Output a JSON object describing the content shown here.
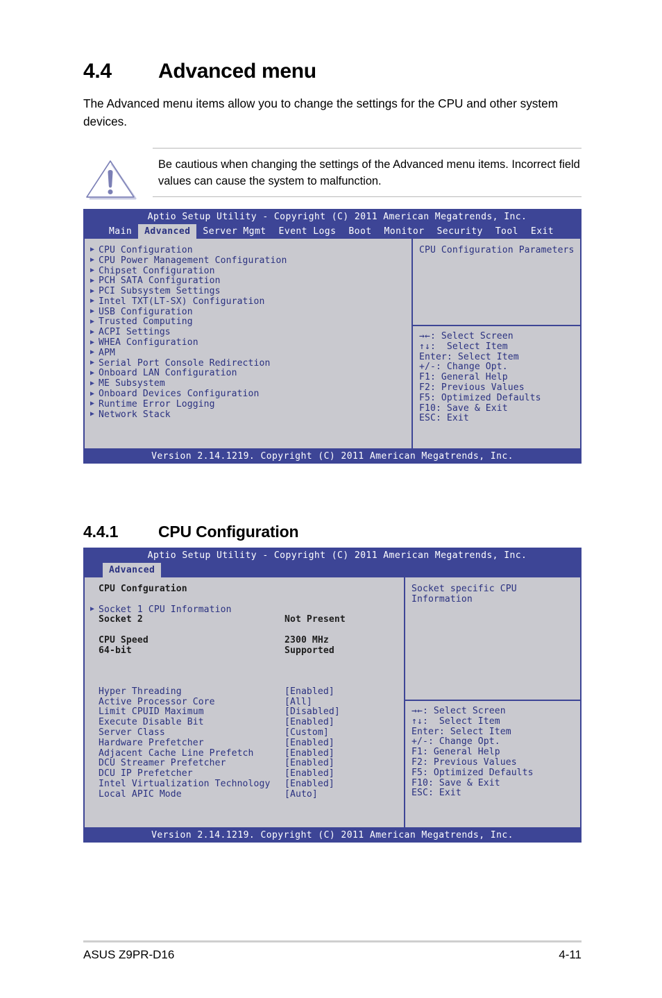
{
  "document": {
    "section": {
      "number": "4.4",
      "title": "Advanced menu"
    },
    "intro": "The Advanced menu items allow you to change the settings for the CPU and other system devices.",
    "note": {
      "icon": "warning-triangle-icon",
      "text": "Be cautious when changing the settings of the Advanced menu items. Incorrect field values can cause the system to malfunction."
    },
    "subsection": {
      "number": "4.4.1",
      "title": "CPU Configuration"
    },
    "footer": {
      "left": "ASUS Z9PR-D16",
      "page": "4-11"
    }
  },
  "colors": {
    "bios_blue": "#3d4596",
    "bios_body": "#c9c9cf",
    "bios_text_blue": "#2a3180",
    "bios_text_white": "#ffffff",
    "note_rule": "#b9b9b9",
    "warning_icon": "#7b7fb5"
  },
  "bios_advanced": {
    "title": "Aptio Setup Utility - Copyright (C) 2011 American Megatrends, Inc.",
    "tabs": [
      {
        "label": "Main",
        "active": false
      },
      {
        "label": "Advanced",
        "active": true
      },
      {
        "label": "Server Mgmt",
        "active": false
      },
      {
        "label": "Event Logs",
        "active": false
      },
      {
        "label": "Boot",
        "active": false
      },
      {
        "label": "Monitor",
        "active": false
      },
      {
        "label": "Security",
        "active": false
      },
      {
        "label": "Tool",
        "active": false
      },
      {
        "label": "Exit",
        "active": false
      }
    ],
    "menu_items": [
      "CPU Configuration",
      "CPU Power Management Configuration",
      "Chipset Configuration",
      "PCH SATA Configuration",
      "PCI Subsystem Settings",
      "Intel TXT(LT-SX) Configuration",
      "USB Configuration",
      "Trusted Computing",
      "ACPI Settings",
      "WHEA Configuration",
      "APM",
      "Serial Port Console Redirection",
      "Onboard LAN Configuration",
      "ME Subsystem",
      "Onboard Devices Configuration",
      "Runtime Error Logging",
      "Network Stack"
    ],
    "help_title": "CPU Configuration Parameters",
    "help_keys": [
      "→←: Select Screen",
      "↑↓:  Select Item",
      "Enter: Select Item",
      "+/-: Change Opt.",
      "F1: General Help",
      "F2: Previous Values",
      "F5: Optimized Defaults",
      "F10: Save & Exit",
      "ESC: Exit"
    ],
    "version": "Version 2.14.1219. Copyright (C) 2011 American Megatrends, Inc."
  },
  "bios_cpu": {
    "title": "Aptio Setup Utility - Copyright (C) 2011 American Megatrends, Inc.",
    "tabs": [
      {
        "label": "Advanced",
        "active": true
      }
    ],
    "section_header": "CPU Confguration",
    "socket_link": "Socket 1 CPU Information",
    "info_rows": [
      {
        "label": "Socket 2",
        "value": "Not Present"
      }
    ],
    "spec_rows": [
      {
        "label": "CPU Speed",
        "value": "2300 MHz"
      },
      {
        "label": "64-bit",
        "value": "Supported"
      }
    ],
    "settings": [
      {
        "label": "Hyper Threading",
        "value": "[Enabled]"
      },
      {
        "label": "Active Processor Core",
        "value": "[All]"
      },
      {
        "label": "Limit CPUID Maximum",
        "value": "[Disabled]"
      },
      {
        "label": "Execute Disable Bit",
        "value": "[Enabled]"
      },
      {
        "label": "Server Class",
        "value": "[Custom]"
      },
      {
        "label": "Hardware Prefetcher",
        "value": "[Enabled]"
      },
      {
        "label": "Adjacent Cache Line Prefetch",
        "value": "[Enabled]"
      },
      {
        "label": "DCU Streamer Prefetcher",
        "value": "[Enabled]"
      },
      {
        "label": "DCU IP Prefetcher",
        "value": "[Enabled]"
      },
      {
        "label": "Intel Virtualization Technology",
        "value": "[Enabled]"
      },
      {
        "label": "Local APIC Mode",
        "value": "[Auto]"
      }
    ],
    "help_title": "Socket specific CPU Information",
    "help_keys": [
      "→←: Select Screen",
      "↑↓:  Select Item",
      "Enter: Select Item",
      "+/-: Change Opt.",
      "F1: General Help",
      "F2: Previous Values",
      "F5: Optimized Defaults",
      "F10: Save & Exit",
      "ESC: Exit"
    ],
    "version": "Version 2.14.1219. Copyright (C) 2011 American Megatrends, Inc."
  }
}
